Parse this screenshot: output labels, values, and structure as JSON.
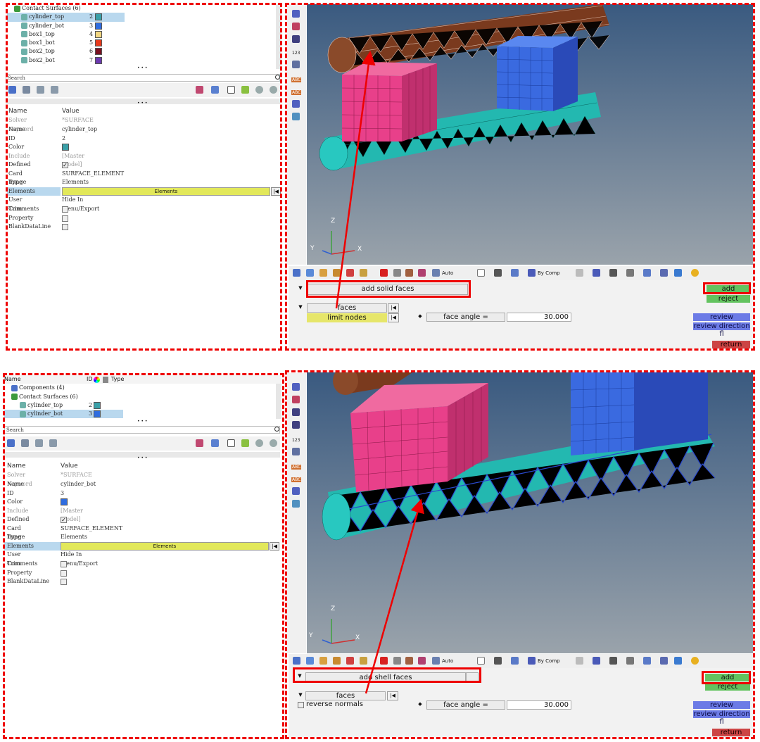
{
  "top": {
    "tree": {
      "group": "Contact Surfaces (6)",
      "items": [
        {
          "label": "cylinder_top",
          "id": "2",
          "color": "#3aa0a8"
        },
        {
          "label": "cylinder_bot",
          "id": "3",
          "color": "#2f6de0"
        },
        {
          "label": "box1_top",
          "id": "4",
          "color": "#f2d680"
        },
        {
          "label": "box1_bot",
          "id": "5",
          "color": "#e83a1c"
        },
        {
          "label": "box2_top",
          "id": "6",
          "color": "#7a1020"
        },
        {
          "label": "box2_bot",
          "id": "7",
          "color": "#6c3ab0"
        }
      ]
    },
    "search": "Search",
    "ellipsis1": "• • •",
    "ellipsis2": "• • •",
    "props": {
      "header_name": "Name",
      "header_value": "Value",
      "rows": [
        {
          "name": "Solver Keyword",
          "value": "*SURFACE"
        },
        {
          "name": "Name",
          "value": "cylinder_top"
        },
        {
          "name": "ID",
          "value": "2"
        },
        {
          "name": "Color",
          "value": ""
        },
        {
          "name": "Include",
          "value": "[Master Model]"
        },
        {
          "name": "Defined",
          "value": ""
        },
        {
          "name": "Card Image",
          "value": "SURFACE_ELEMENT"
        },
        {
          "name": "Type",
          "value": "Elements"
        },
        {
          "name": "Elements",
          "value": "Elements"
        },
        {
          "name": "User Comments",
          "value": "Hide In Menu/Export"
        },
        {
          "name": "Trim",
          "value": ""
        },
        {
          "name": "Property",
          "value": ""
        },
        {
          "name": "BlankDataLine",
          "value": ""
        }
      ],
      "color": "#3aa0a8",
      "check": "✓"
    },
    "toolbar": {
      "auto": "Auto",
      "bycomp": "By Comp"
    },
    "panel": {
      "main_btn": "add solid faces",
      "faces": "faces",
      "limit_nodes": "limit nodes",
      "face_angle": "face angle =",
      "face_angle_val": "30.000",
      "add": "add",
      "reject": "reject",
      "review": "review",
      "review_dir": "review direction fl",
      "return": "return"
    },
    "axis": {
      "z": "Z",
      "y": "Y",
      "x": "X"
    },
    "vt_labels": {
      "n123": "123",
      "abc": "ABC"
    }
  },
  "bottom": {
    "tree": {
      "header_name": "Name",
      "header_id": "ID",
      "header_type": "Type",
      "components": "Components (4)",
      "group": "Contact Surfaces (6)",
      "items": [
        {
          "label": "cylinder_top",
          "id": "2",
          "color": "#3aa0a8"
        },
        {
          "label": "cylinder_bot",
          "id": "3",
          "color": "#2f6de0"
        }
      ]
    },
    "search": "Search",
    "ellipsis1": "• • •",
    "ellipsis2": "• • •",
    "props": {
      "header_name": "Name",
      "header_value": "Value",
      "rows": [
        {
          "name": "Solver Keyword",
          "value": "*SURFACE"
        },
        {
          "name": "Name",
          "value": "cylinder_bot"
        },
        {
          "name": "ID",
          "value": "3"
        },
        {
          "name": "Color",
          "value": ""
        },
        {
          "name": "Include",
          "value": "[Master Model]"
        },
        {
          "name": "Defined",
          "value": ""
        },
        {
          "name": "Card Image",
          "value": "SURFACE_ELEMENT"
        },
        {
          "name": "Type",
          "value": "Elements"
        },
        {
          "name": "Elements",
          "value": "Elements"
        },
        {
          "name": "User Comments",
          "value": "Hide In Menu/Export"
        },
        {
          "name": "Trim",
          "value": ""
        },
        {
          "name": "Property",
          "value": ""
        },
        {
          "name": "BlankDataLine",
          "value": ""
        }
      ],
      "color": "#2f6de0",
      "check": "✓"
    },
    "toolbar": {
      "auto": "Auto",
      "bycomp": "By Comp"
    },
    "panel": {
      "main_btn": "add shell faces",
      "faces": "faces",
      "reverse_normals": "reverse normals",
      "face_angle": "face angle =",
      "face_angle_val": "30.000",
      "add": "add",
      "reject": "reject",
      "review": "review",
      "review_dir": "review direction fl",
      "return": "return"
    },
    "axis": {
      "z": "Z",
      "y": "Y",
      "x": "X"
    },
    "vt_labels": {
      "n123": "123",
      "abc": "ABC"
    }
  }
}
